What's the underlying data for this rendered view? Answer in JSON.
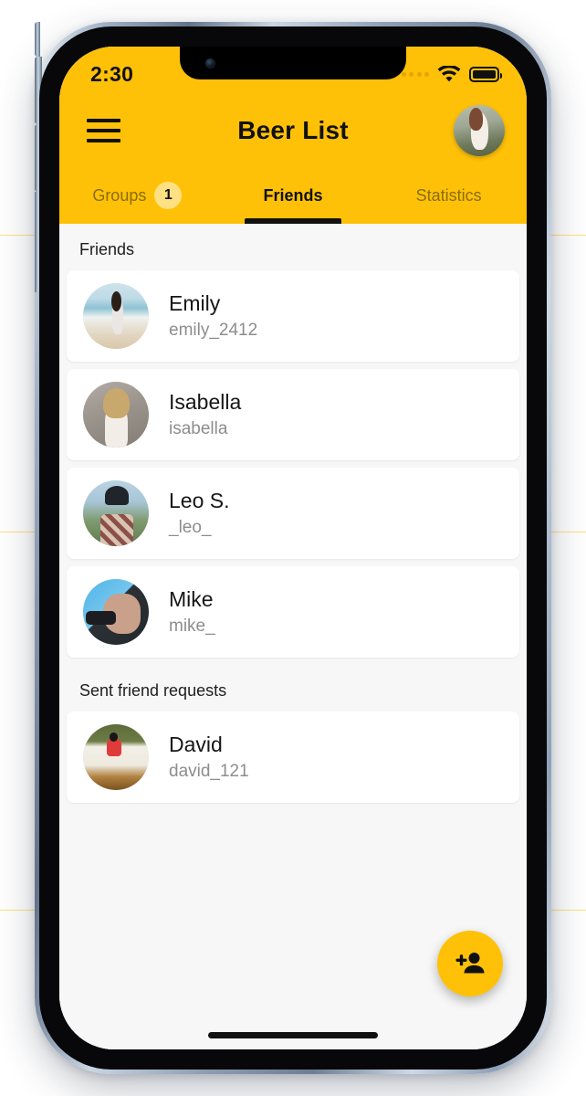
{
  "status_bar": {
    "time": "2:30",
    "signal_icon": "signal-dots-icon",
    "wifi_icon": "wifi-icon",
    "battery_icon": "battery-full-icon"
  },
  "nav": {
    "menu_icon": "hamburger-menu-icon",
    "title": "Beer List",
    "avatar_icon": "profile-avatar-image"
  },
  "tabs": [
    {
      "label": "Groups",
      "badge": "1",
      "active": false
    },
    {
      "label": "Friends",
      "badge": null,
      "active": true
    },
    {
      "label": "Statistics",
      "badge": null,
      "active": false
    }
  ],
  "sections": [
    {
      "title": "Friends",
      "items": [
        {
          "name": "Emily",
          "handle": "emily_2412",
          "avatar": "emily-avatar-image"
        },
        {
          "name": "Isabella",
          "handle": "isabella",
          "avatar": "isabella-avatar-image"
        },
        {
          "name": "Leo S.",
          "handle": "_leo_",
          "avatar": "leo-avatar-image"
        },
        {
          "name": "Mike",
          "handle": "mike_",
          "avatar": "mike-avatar-image"
        }
      ]
    },
    {
      "title": "Sent friend requests",
      "items": [
        {
          "name": "David",
          "handle": "david_121",
          "avatar": "david-avatar-image"
        }
      ]
    }
  ],
  "fab": {
    "icon": "person-add-icon",
    "label": "Add friend"
  },
  "colors": {
    "accent_yellow": "#FFC107",
    "badge_yellow": "#FFE082",
    "text_primary": "#161616",
    "text_secondary": "#8d8d8d",
    "tab_inactive": "#8a6d0a",
    "surface": "#ffffff",
    "background": "#f7f7f7"
  }
}
